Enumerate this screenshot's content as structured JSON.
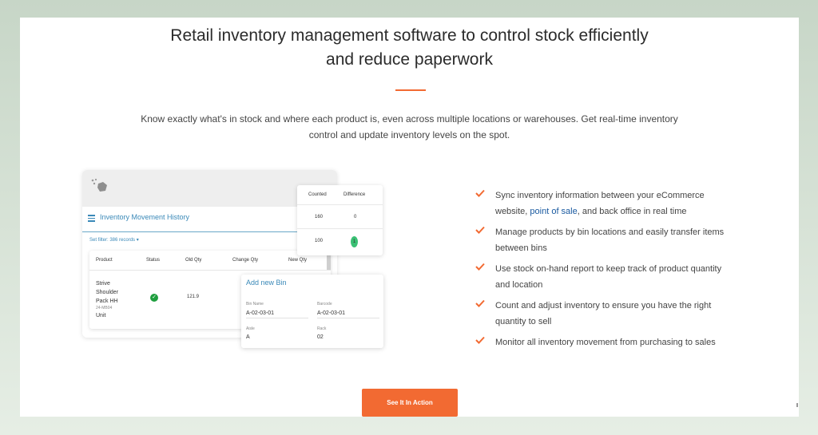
{
  "heading": {
    "line1": "Retail inventory management software to control stock efficiently",
    "line2": "and reduce paperwork"
  },
  "description": {
    "line1": "Know exactly what's in stock and where each product is, even across multiple locations or warehouses. Get real-time inventory",
    "line2": "control and update inventory levels on the spot."
  },
  "accent_color": "#f26a32",
  "mockup": {
    "panel_title": "Inventory Movement History",
    "filter_label": "Set filter: 386 records ▾",
    "table": {
      "headers": [
        "Product",
        "Status",
        "Old Qty",
        "Change Qty",
        "New Qty"
      ],
      "row": {
        "product_lines": [
          "Strive",
          "Shoulder",
          "Pack HH"
        ],
        "sku": "24-MB04",
        "unit": "Unit",
        "old_qty": "121.9"
      }
    },
    "counted_card": {
      "headers": [
        "Counted",
        "Difference"
      ],
      "rows": [
        {
          "counted": "160",
          "difference": "0"
        },
        {
          "counted": "100",
          "difference": "1"
        }
      ]
    },
    "bin_card": {
      "title": "Add new Bin",
      "bin_name_label": "Bin Name",
      "bin_name_value": "A-02-03-01",
      "barcode_label": "Barcode",
      "barcode_value": "A-02-03-01",
      "aisle_label": "Aisle",
      "aisle_value": "A",
      "rack_label": "Rack",
      "rack_value": "02"
    }
  },
  "features": [
    {
      "line1_pre": "Sync inventory information between your eCommerce",
      "line2_pre": "website, ",
      "link": "point of sale",
      "line2_post": ", and back office in real time"
    },
    {
      "line1": "Manage products by bin locations and easily transfer items",
      "line2": "between bins"
    },
    {
      "line1": "Use stock on-hand report to keep track of product quantity",
      "line2": "and location"
    },
    {
      "line1": "Count and adjust inventory to ensure you have the right",
      "line2": "quantity to sell"
    },
    {
      "line1": "Monitor all inventory movement from purchasing to sales",
      "line2": ""
    }
  ],
  "cta_label": "See It In Action"
}
